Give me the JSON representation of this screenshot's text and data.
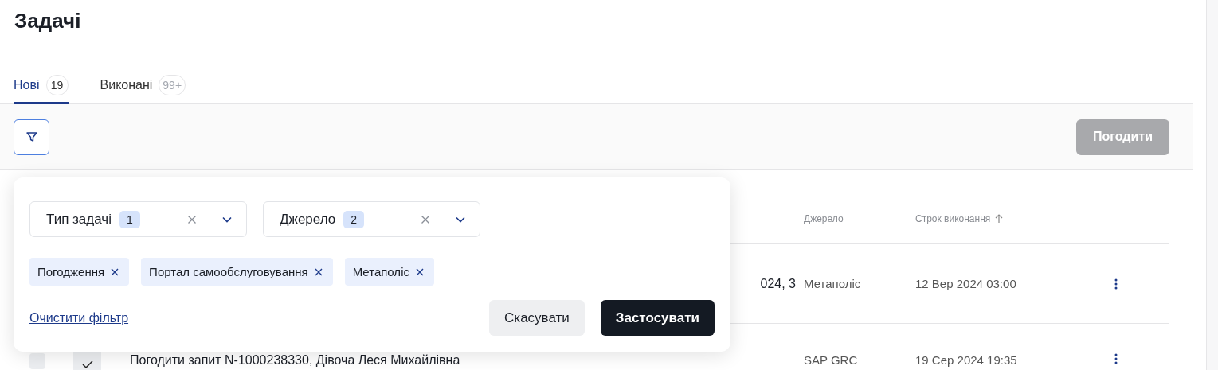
{
  "page_title": "Задачі",
  "tabs": [
    {
      "label": "Нові",
      "count": "19",
      "selected": true
    },
    {
      "label": "Виконані",
      "count": "99+",
      "selected": false
    }
  ],
  "toolbar": {
    "approve_button": {
      "label": "Погодити",
      "disabled": true
    }
  },
  "table": {
    "columns": [
      {
        "label": "Джерело",
        "sorted_ascending": false
      },
      {
        "label": "Строк виконання",
        "sorted_ascending": true
      }
    ],
    "rows": [
      {
        "title": "024, 3",
        "title_cut": true,
        "source": "Метаполіс",
        "due": "12 Вер 2024 03:00"
      },
      {
        "title": "Погодити запит N-1000238330, Дівоча Леся Михайлівна",
        "title_cut": false,
        "checked": false,
        "source": "SAP GRC",
        "due": "19 Сер 2024 19:35"
      }
    ]
  },
  "filter_panel": {
    "selects": [
      {
        "label": "Тип задачі",
        "count": "1"
      },
      {
        "label": "Джерело",
        "count": "2"
      }
    ],
    "chips": [
      "Погодження",
      "Портал самообслуговування",
      "Метаполіс"
    ],
    "clear_link": "Очистити фільтр",
    "cancel_button": "Скасувати",
    "apply_button": "Застосувати"
  }
}
